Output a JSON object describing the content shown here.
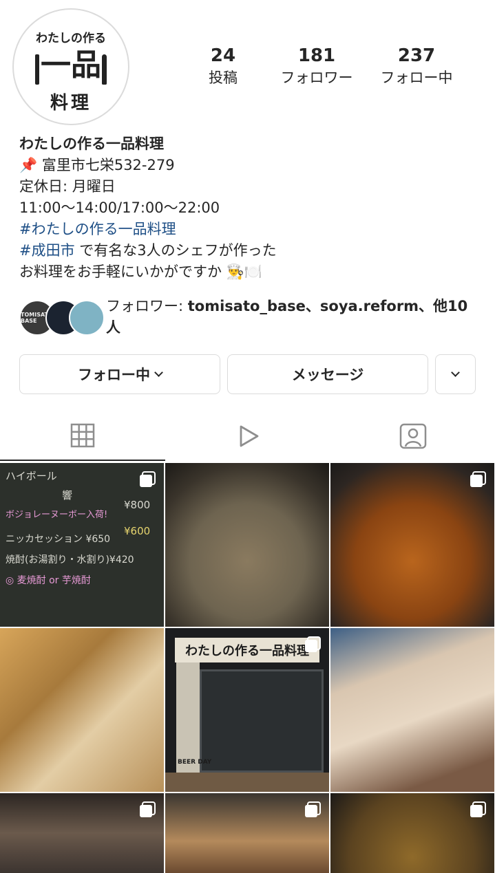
{
  "profile": {
    "avatar_text_top": "わたしの作る",
    "avatar_text_mid": "一品",
    "avatar_text_bottom": "料理",
    "stats": [
      {
        "count": "24",
        "label": "投稿"
      },
      {
        "count": "181",
        "label": "フォロワー"
      },
      {
        "count": "237",
        "label": "フォロー中"
      }
    ],
    "name": "わたしの作る一品料理",
    "bio": {
      "address_icon": "📌",
      "address": " 富里市七栄532-279",
      "holiday": "定休日: 月曜日",
      "hours": "11:00〜14:00/17:00〜22:00",
      "hashtag1": "#わたしの作る一品料理",
      "hashtag2": "#成田市",
      "line5_rest": " で有名な3人のシェフが作った",
      "line6": "お料理をお手軽にいかがですか 👨‍🍳🍽️"
    }
  },
  "followed_by": {
    "prefix": "フォロワー: ",
    "users": "tomisato_base、soya.reform、他10",
    "suffix": "人",
    "avatar1_text": "TOMISATO BASE"
  },
  "buttons": {
    "follow": "フォロー中",
    "message": "メッセージ"
  },
  "tabs": [
    "grid-icon",
    "reels-icon",
    "tagged-icon"
  ],
  "grid": {
    "post1": {
      "lines": [
        "ハイボール",
        "響",
        "ボジョレーヌーボー入荷!",
        "¥800",
        "¥600",
        "ニッカセッション ¥650",
        "焼酎(お湯割り・水割り)¥420",
        "◎ 麦焼酎 or 芋焼酎"
      ]
    },
    "post5": {
      "sign": "わたしの作る一品料理",
      "banner": "BEER DAY"
    }
  },
  "colors": {
    "text": "#262626",
    "hashtag": "#1e4f86",
    "border": "#dbdbdb"
  }
}
